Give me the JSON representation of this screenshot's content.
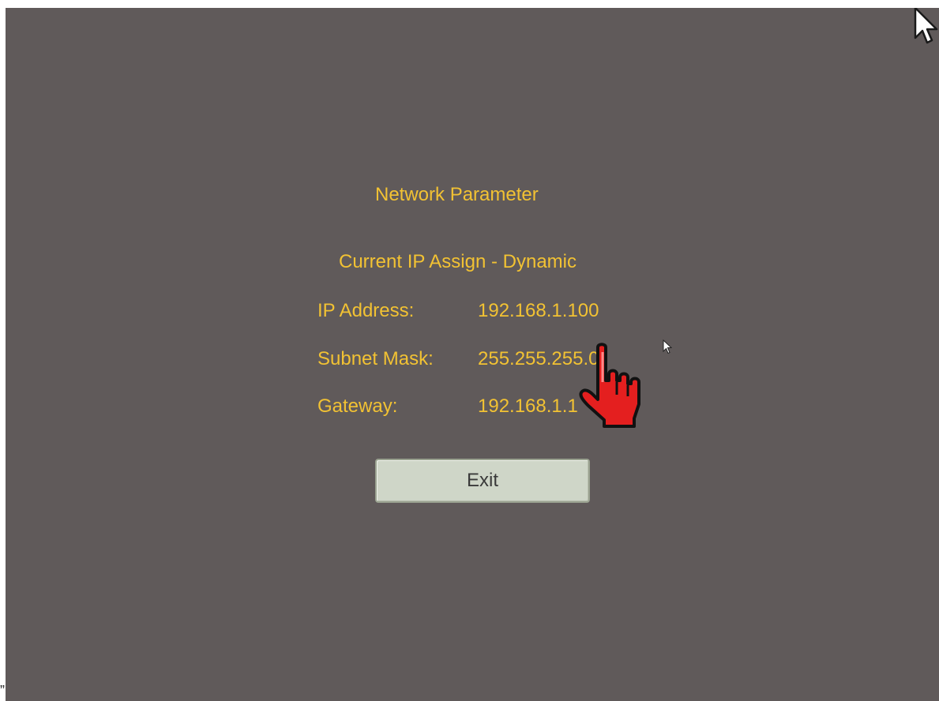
{
  "dialog": {
    "title": "Network Parameter",
    "ip_assign": "Current IP Assign - Dynamic"
  },
  "network": {
    "ip_label": "IP Address:",
    "ip_value": "192.168.1.100",
    "subnet_label": "Subnet Mask:",
    "subnet_value": "255.255.255.0",
    "gateway_label": "Gateway:",
    "gateway_value": "192.168.1.1"
  },
  "buttons": {
    "exit_label": "Exit"
  },
  "colors": {
    "background": "#605a5a",
    "text": "#f2c233",
    "button_face": "#cfd6c8",
    "hand_cursor": "#e41f1f"
  },
  "icons": {
    "top_cursor": "arrow-pointer-icon",
    "small_cursor": "arrow-pointer-icon",
    "hand_cursor": "pointing-hand-icon"
  },
  "stray_mark": "”"
}
